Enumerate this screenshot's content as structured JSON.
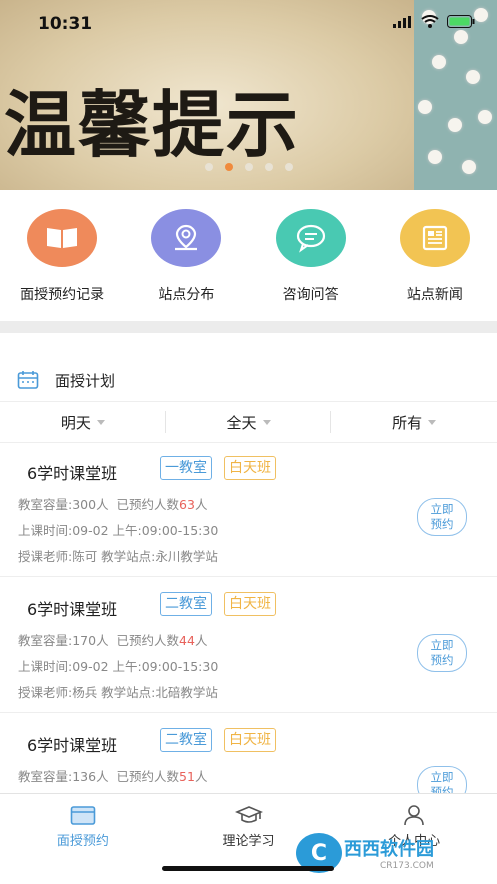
{
  "status": {
    "time": "10:31"
  },
  "banner": {
    "title": "温馨提示"
  },
  "quick_links": [
    {
      "label": "面授预约记录",
      "color": "#ef8a5b",
      "icon": "book-icon"
    },
    {
      "label": "站点分布",
      "color": "#8a8fe2",
      "icon": "location-icon"
    },
    {
      "label": "咨询问答",
      "color": "#49c9b2",
      "icon": "chat-icon"
    },
    {
      "label": "站点新闻",
      "color": "#f2c453",
      "icon": "news-icon"
    }
  ],
  "plan": {
    "title": "面授计划"
  },
  "filters": [
    "明天",
    "全天",
    "所有"
  ],
  "courses": [
    {
      "title": "6学时课堂班",
      "room": "一教室",
      "type": "白天班",
      "capacity": "教室容量:300人",
      "booked_label": "已预约人数",
      "booked": "63",
      "booked_unit": "人",
      "time": "上课时间:09-02  上午:09:00-15:30",
      "teacher": "授课老师:陈可  教学站点:永川教学站",
      "button": [
        "立即",
        "预约"
      ]
    },
    {
      "title": "6学时课堂班",
      "room": "二教室",
      "type": "白天班",
      "capacity": "教室容量:170人",
      "booked_label": "已预约人数",
      "booked": "44",
      "booked_unit": "人",
      "time": "上课时间:09-02  上午:09:00-15:30",
      "teacher": "授课老师:杨兵  教学站点:北碚教学站",
      "button": [
        "立即",
        "预约"
      ]
    },
    {
      "title": "6学时课堂班",
      "room": "二教室",
      "type": "白天班",
      "capacity": "教室容量:136人",
      "booked_label": "已预约人数",
      "booked": "51",
      "booked_unit": "人",
      "button": [
        "立即",
        "预约"
      ]
    }
  ],
  "tabs": [
    {
      "label": "面授预约",
      "icon": "calendar-icon",
      "active": true
    },
    {
      "label": "理论学习",
      "icon": "graduation-cap-icon",
      "active": false
    },
    {
      "label": "个人中心",
      "icon": "person-icon",
      "active": false
    }
  ],
  "watermark": {
    "logo": "C",
    "text": "西西软件园",
    "sub": "CR173.COM"
  },
  "colors": {
    "accent": "#4a9ad8",
    "highlight": "#e8625b",
    "tag_orange": "#f0b445"
  }
}
